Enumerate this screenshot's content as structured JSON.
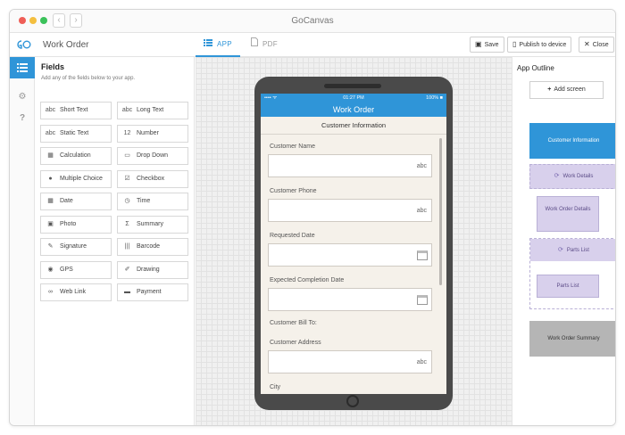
{
  "window": {
    "title": "GoCanvas"
  },
  "toolbar": {
    "doc_title": "Work Order",
    "tabs": [
      {
        "label": "APP",
        "icon": "list-icon"
      },
      {
        "label": "PDF",
        "icon": "pdf-file-icon"
      }
    ],
    "save_label": "Save",
    "publish_label": "Publish to device",
    "close_label": "Close"
  },
  "fields_panel": {
    "title": "Fields",
    "subtitle": "Add any of the fields below to your app.",
    "items": [
      {
        "label": "Short Text",
        "glyph": "abc"
      },
      {
        "label": "Long Text",
        "glyph": "abc"
      },
      {
        "label": "Static Text",
        "glyph": "abc"
      },
      {
        "label": "Number",
        "glyph": "12"
      },
      {
        "label": "Calculation",
        "glyph": "▦"
      },
      {
        "label": "Drop Down",
        "glyph": "▭"
      },
      {
        "label": "Multiple Choice",
        "glyph": "●"
      },
      {
        "label": "Checkbox",
        "glyph": "☑"
      },
      {
        "label": "Date",
        "glyph": "▦"
      },
      {
        "label": "Time",
        "glyph": "◷"
      },
      {
        "label": "Photo",
        "glyph": "▣"
      },
      {
        "label": "Summary",
        "glyph": "Σ"
      },
      {
        "label": "Signature",
        "glyph": "✎"
      },
      {
        "label": "Barcode",
        "glyph": "|||"
      },
      {
        "label": "GPS",
        "glyph": "◉"
      },
      {
        "label": "Drawing",
        "glyph": "✐"
      },
      {
        "label": "Web Link",
        "glyph": "∞"
      },
      {
        "label": "Payment",
        "glyph": "▬"
      }
    ]
  },
  "phone": {
    "status_time": "01:27 PM",
    "status_battery": "100% ■",
    "status_left": "•••• ᯤ",
    "app_title": "Work Order",
    "section_title": "Customer Information",
    "fields": [
      {
        "label": "Customer Name",
        "hint": "abc"
      },
      {
        "label": "Customer Phone",
        "hint": "abc"
      },
      {
        "label": "Requested Date",
        "hint": ""
      },
      {
        "label": "Expected Completion Date",
        "hint": ""
      },
      {
        "label": "Customer Bill To:"
      },
      {
        "label": "Customer Address",
        "hint": "abc"
      },
      {
        "label": "City"
      }
    ]
  },
  "outline": {
    "title": "App Outline",
    "add_screen_label": "Add screen",
    "screens": [
      {
        "label": "Customer Information"
      },
      {
        "label": "Work Details"
      },
      {
        "label": "Work Order Details"
      },
      {
        "label": "Parts List"
      },
      {
        "label": "Parts List"
      },
      {
        "label": "Work Order Summary"
      }
    ]
  },
  "colors": {
    "accent": "#2f95d8",
    "group": "#d8d0ec",
    "summary": "#b5b5b5"
  }
}
